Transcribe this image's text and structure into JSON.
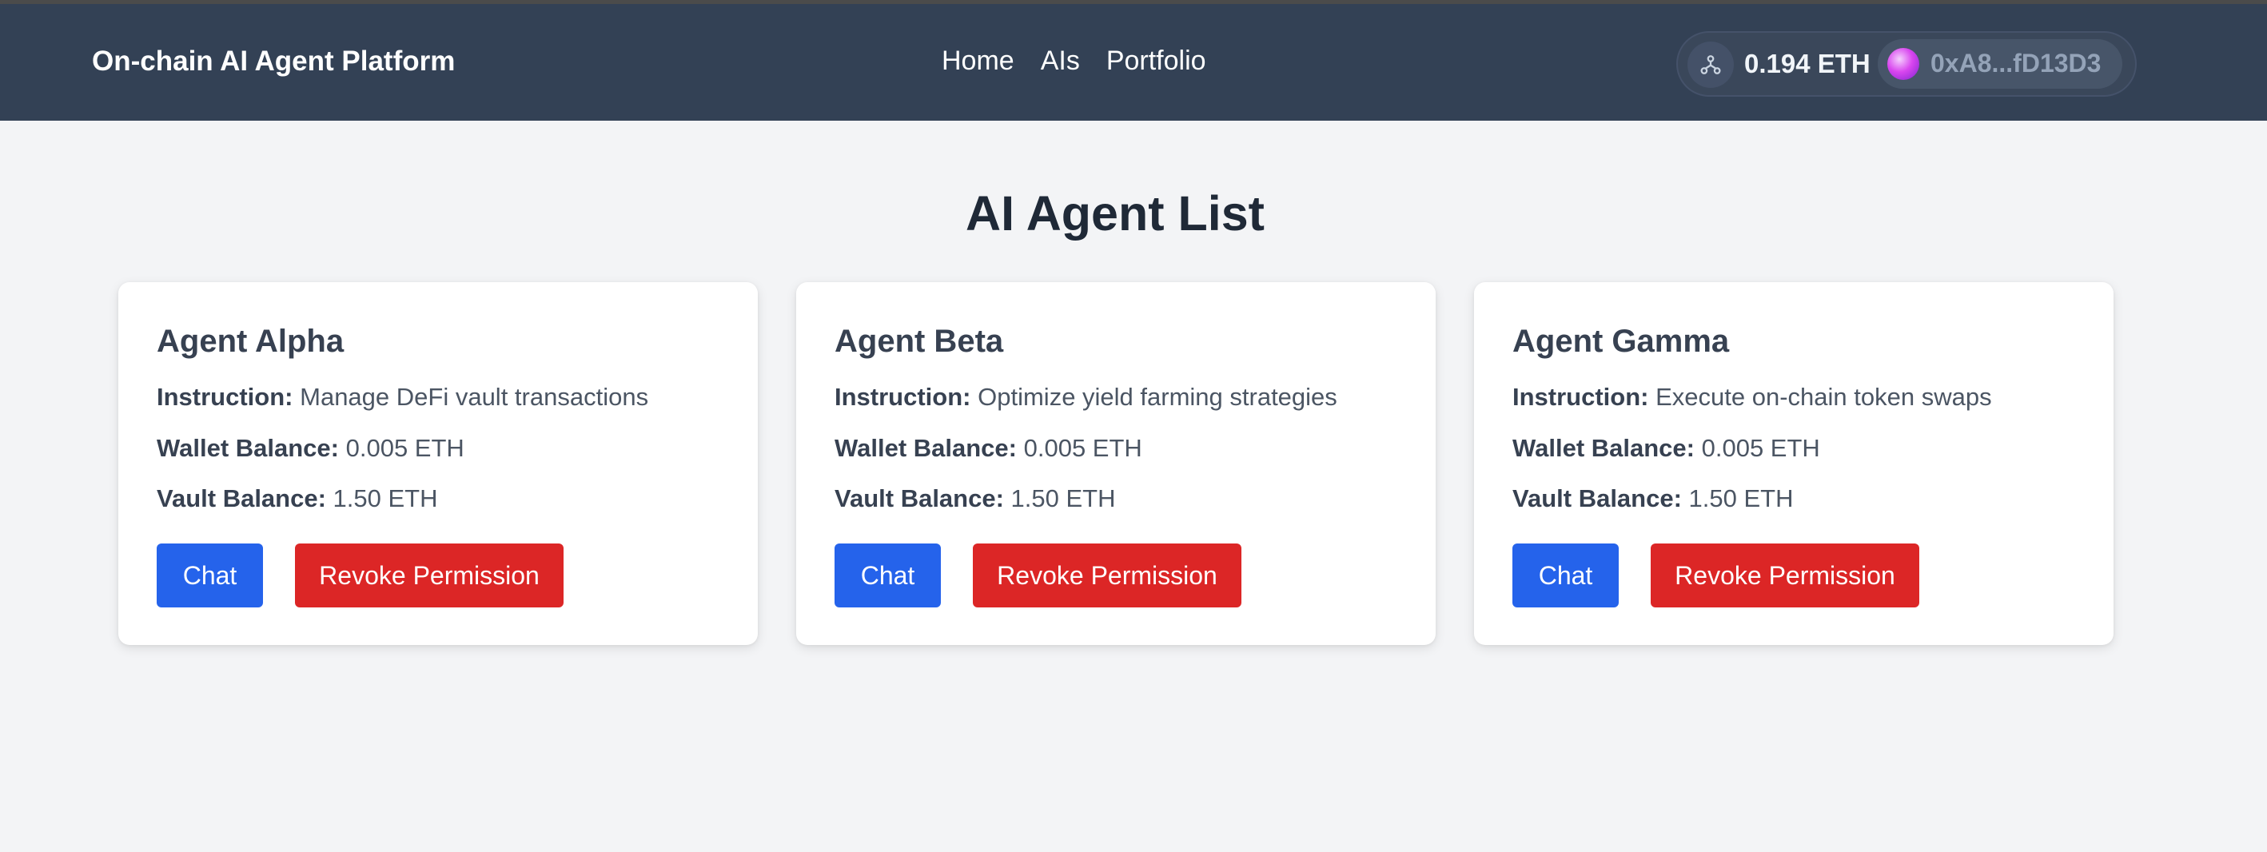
{
  "navbar": {
    "brand": "On-chain AI Agent Platform",
    "links": [
      "Home",
      "AIs",
      "Portfolio"
    ],
    "wallet": {
      "network_icon": "network-icon",
      "balance": "0.194 ETH",
      "address": "0xA8...fD13D3"
    }
  },
  "page": {
    "title": "AI Agent List"
  },
  "labels": {
    "instruction": "Instruction:",
    "wallet_balance": "Wallet Balance:",
    "vault_balance": "Vault Balance:",
    "chat": "Chat",
    "revoke": "Revoke Permission"
  },
  "agents": [
    {
      "name": "Agent Alpha",
      "instruction": "Manage DeFi vault transactions",
      "wallet_balance": "0.005 ETH",
      "vault_balance": "1.50 ETH"
    },
    {
      "name": "Agent Beta",
      "instruction": "Optimize yield farming strategies",
      "wallet_balance": "0.005 ETH",
      "vault_balance": "1.50 ETH"
    },
    {
      "name": "Agent Gamma",
      "instruction": "Execute on-chain token swaps",
      "wallet_balance": "0.005 ETH",
      "vault_balance": "1.50 ETH"
    }
  ],
  "colors": {
    "navbar": "#334155",
    "background": "#f3f4f6",
    "chat_button": "#2563eb",
    "revoke_button": "#dc2626"
  }
}
